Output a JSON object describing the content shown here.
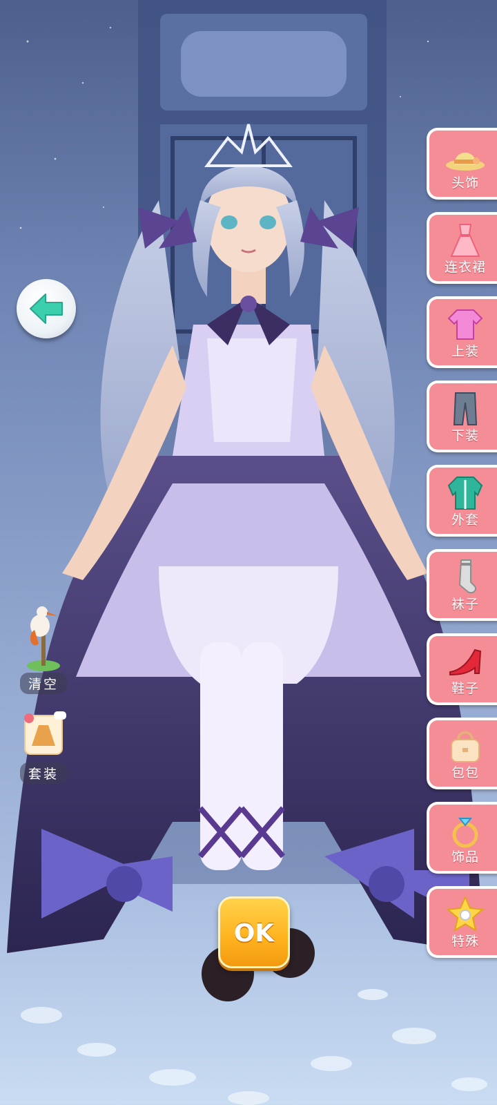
{
  "tabs": [
    {
      "label": "头饰",
      "icon": "hat-icon"
    },
    {
      "label": "连衣裙",
      "icon": "dress-icon"
    },
    {
      "label": "上装",
      "icon": "top-icon"
    },
    {
      "label": "下装",
      "icon": "pants-icon"
    },
    {
      "label": "外套",
      "icon": "coat-icon"
    },
    {
      "label": "袜子",
      "icon": "sock-icon"
    },
    {
      "label": "鞋子",
      "icon": "heel-shoe-icon"
    },
    {
      "label": "包包",
      "icon": "handbag-icon"
    },
    {
      "label": "饰品",
      "icon": "ring-icon"
    },
    {
      "label": "特殊",
      "icon": "star-icon"
    }
  ],
  "tools": {
    "clear_label": "清空",
    "outfit_label": "套装"
  },
  "confirm": {
    "label": "OK"
  },
  "colors": {
    "tab_bg": "#f58d96",
    "tab_border": "#ffffff",
    "back_arrow": "#3ccfae",
    "ok_button": "#ffb21e"
  }
}
